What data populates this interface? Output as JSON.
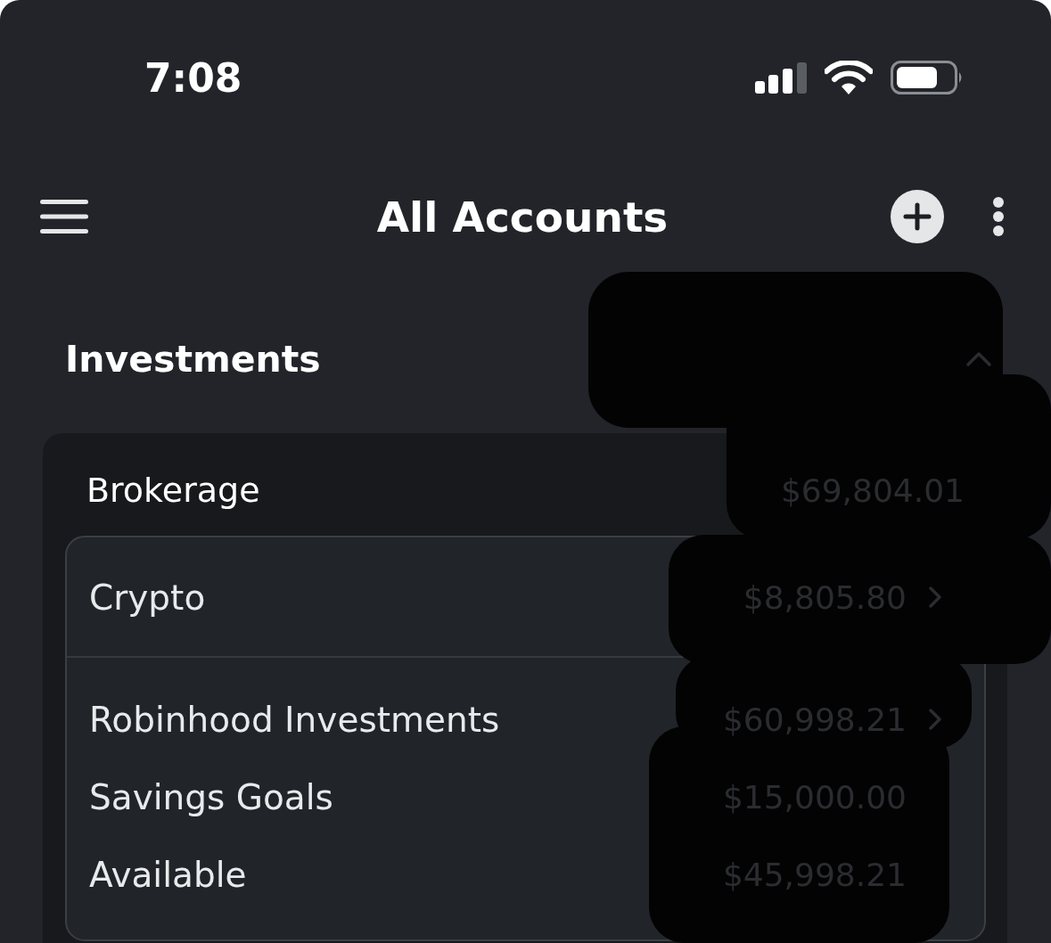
{
  "status_bar": {
    "time": "7:08"
  },
  "header": {
    "title": "All Accounts"
  },
  "section": {
    "title": "Investments",
    "expanded": true,
    "group": {
      "name": "Brokerage",
      "amount": "$69,804.01",
      "accounts": [
        {
          "label": "Crypto",
          "amount": "$8,805.80"
        },
        {
          "label": "Robinhood Investments",
          "amount": "$60,998.21",
          "details": [
            {
              "label": "Savings Goals",
              "amount": "$15,000.00"
            },
            {
              "label": "Available",
              "amount": "$45,998.21"
            }
          ]
        }
      ]
    }
  }
}
